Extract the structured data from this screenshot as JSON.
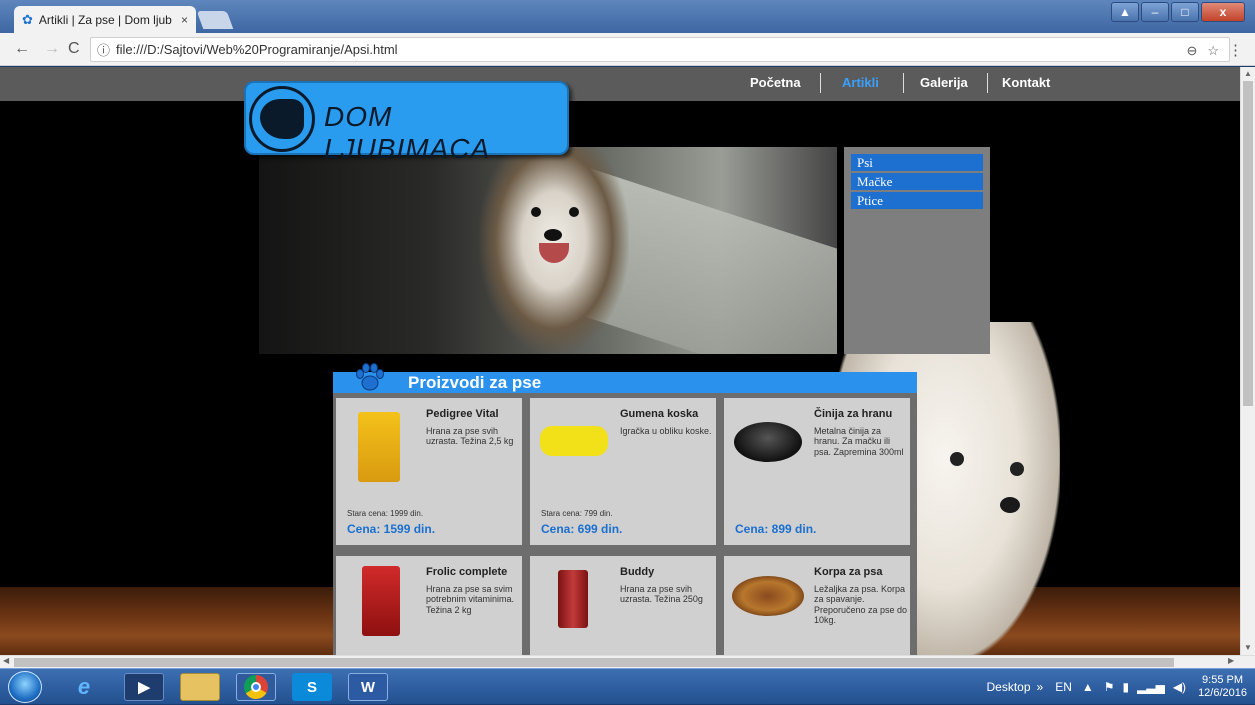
{
  "browser": {
    "tab_title": "Artikli | Za pse | Dom ljub",
    "tab_close": "×",
    "url": "file:///D:/Sajtovi/Web%20Programiranje/Apsi.html"
  },
  "site": {
    "logo_text": "DOM LJUBIMACA",
    "nav": [
      {
        "label": "Početna"
      },
      {
        "label": "Artikli",
        "active": true
      },
      {
        "label": "Galerija"
      },
      {
        "label": "Kontakt"
      }
    ],
    "side_menu": [
      {
        "label": "Psi"
      },
      {
        "label": "Mačke"
      },
      {
        "label": "Ptice"
      }
    ],
    "products_title": "Proizvodi za pse",
    "products": [
      {
        "name": "Pedigree Vital",
        "desc": "Hrana za pse svih uzrasta. Težina 2,5 kg",
        "old_price": "Stara cena: 1999 din.",
        "price": "Cena: 1599 din."
      },
      {
        "name": "Gumena koska",
        "desc": "Igračka u obliku koske.",
        "old_price": "Stara cena: 799 din.",
        "price": "Cena: 699 din."
      },
      {
        "name": "Činija za hranu",
        "desc": "Metalna činija za hranu. Za mačku ili psa. Zapremina 300ml",
        "old_price": "",
        "price": "Cena: 899 din."
      },
      {
        "name": "Frolic complete",
        "desc": "Hrana za pse sa svim potrebnim vitaminima. Težina 2 kg",
        "old_price": "",
        "price": ""
      },
      {
        "name": "Buddy",
        "desc": "Hrana za pse svih uzrasta. Težina 250g",
        "old_price": "",
        "price": ""
      },
      {
        "name": "Korpa za psa",
        "desc": "Ležaljka za psa. Korpa za spavanje. Preporučeno za pse do 10kg.",
        "old_price": "",
        "price": ""
      }
    ]
  },
  "taskbar": {
    "desktop_label": "Desktop",
    "lang": "EN",
    "time": "9:55 PM",
    "date": "12/6/2016"
  },
  "colors": {
    "accent": "#2a91ec",
    "price": "#1a6fd0",
    "nav_active": "#3aa0ff"
  }
}
